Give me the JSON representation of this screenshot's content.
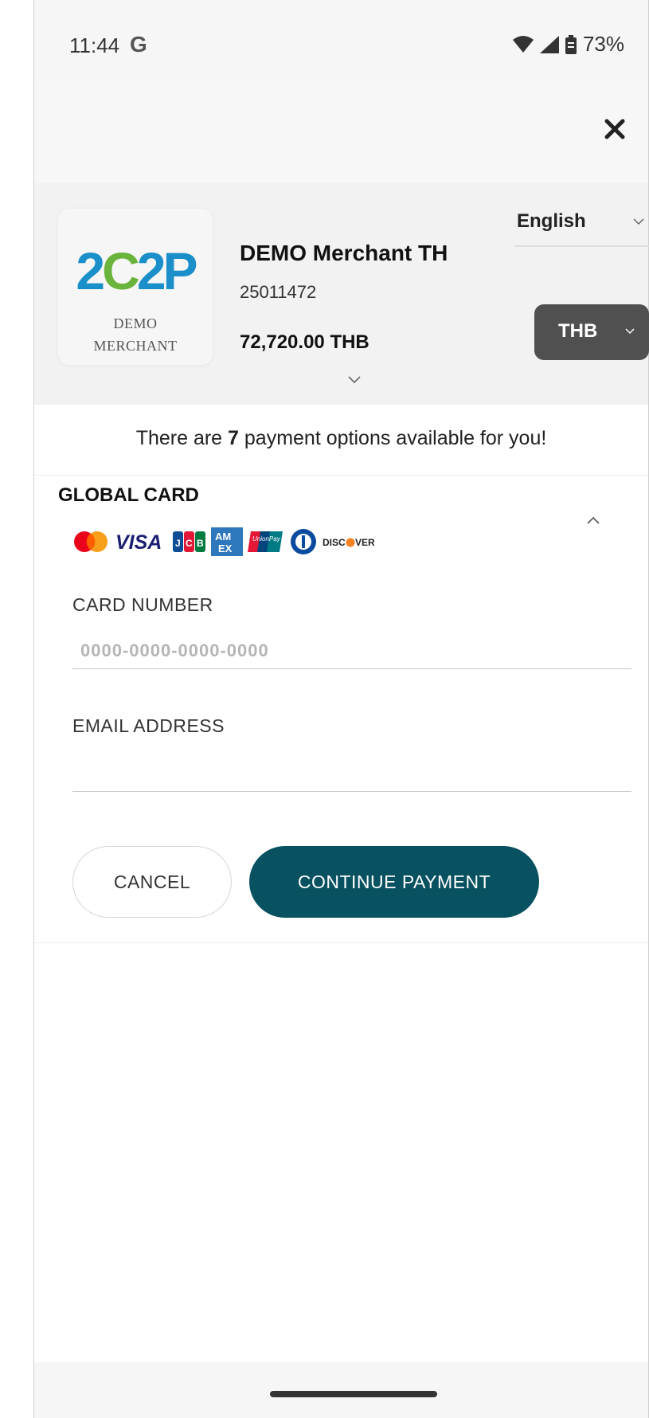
{
  "status_bar": {
    "time": "11:44",
    "google_icon": "G",
    "battery": "73%"
  },
  "merchant": {
    "logo_text": "2C2P",
    "logo_sub_line1": "DEMO",
    "logo_sub_line2": "MERCHANT",
    "name": "DEMO Merchant TH",
    "id": "25011472",
    "amount": "72,720.00 THB"
  },
  "language": {
    "selected": "English"
  },
  "currency": {
    "selected": "THB"
  },
  "options_info": {
    "prefix": "There are ",
    "count": "7",
    "suffix": " payment options available for you!"
  },
  "section": {
    "title": "GLOBAL CARD",
    "card_brands": [
      "mastercard",
      "visa",
      "jcb",
      "amex",
      "unionpay",
      "diners",
      "discover"
    ]
  },
  "form": {
    "card_number_label": "CARD NUMBER",
    "card_number_placeholder": "0000-0000-0000-0000",
    "email_label": "EMAIL ADDRESS",
    "email_placeholder": ""
  },
  "buttons": {
    "cancel": "CANCEL",
    "continue": "CONTINUE PAYMENT"
  },
  "colors": {
    "accent": "#075160",
    "currency_button": "#505050",
    "logo_blue": "#1a8fc9",
    "logo_green": "#6ab43e"
  }
}
